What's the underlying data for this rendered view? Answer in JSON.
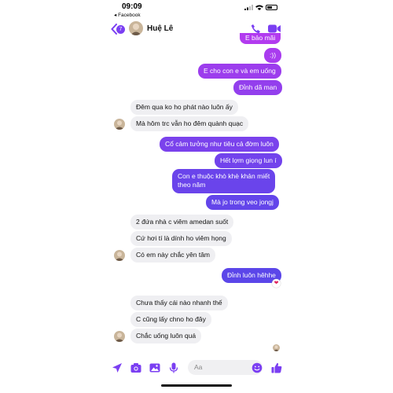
{
  "status": {
    "time": "09:09",
    "back_app": "◂ Facebook"
  },
  "header": {
    "badge": "7",
    "name": "Huệ Lê"
  },
  "messages": [
    {
      "text": "E bảo mãi"
    },
    {
      "text": ":))"
    },
    {
      "text": "E cho con e và em uống"
    },
    {
      "text": "Đỉnh dã man"
    },
    {
      "text": "Đêm qua ko ho phát nào luôn ấy"
    },
    {
      "text": "Mà hôm trc vẫn ho đêm quành quạc"
    },
    {
      "text": "Cổ cảm tưởng như tiêu cả đờm luôn"
    },
    {
      "text": "Hết lợm giọng lun í"
    },
    {
      "text": "Con e thuộc khò khè khản miết theo năm",
      "line1": "Con e thuộc khò khè khản miết",
      "line2": "theo năm"
    },
    {
      "text": "Mà jo trong veo jongj"
    },
    {
      "text": "2 đứa nhà c viêm amedan suốt"
    },
    {
      "text": "Cứ hơi tí là dính ho viêm họng"
    },
    {
      "text": "Có em này chắc yên tâm"
    },
    {
      "text": "Đỉnh luôn hêhhe",
      "reaction": "❤"
    },
    {
      "text": "Chưa thấy cái nào nhanh thế"
    },
    {
      "text": "C cũng lấy chno ho đây"
    },
    {
      "text": "Chắc uống luôn quá"
    }
  ],
  "composer": {
    "placeholder": "Aa"
  },
  "colors": {
    "accent": "#7b3ff2",
    "out_top": "#b03af0",
    "out_bottom": "#5a45e8",
    "incoming": "#efeff2"
  }
}
